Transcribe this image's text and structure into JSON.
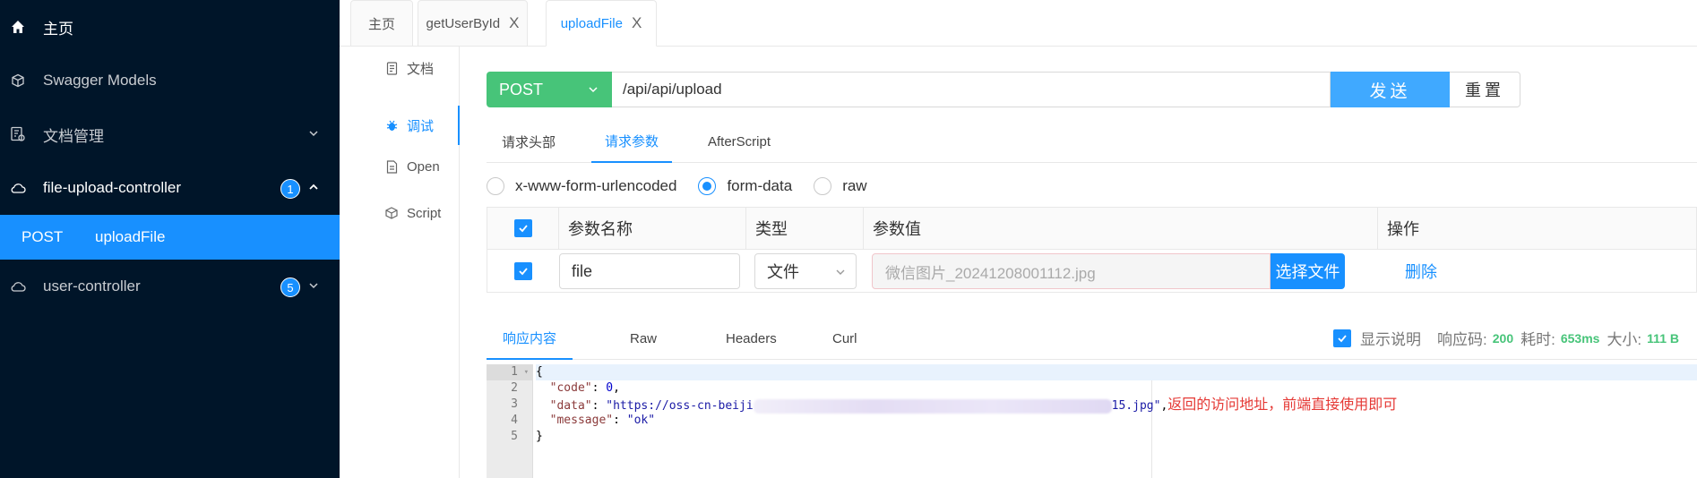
{
  "sidebar": {
    "home": "主页",
    "models": "Swagger Models",
    "docs": "文档管理",
    "group1": {
      "label": "file-upload-controller",
      "count": "1"
    },
    "active_item": {
      "method": "POST",
      "name": "uploadFile"
    },
    "group2": {
      "label": "user-controller",
      "count": "5"
    }
  },
  "tabs": [
    {
      "label": "主页"
    },
    {
      "label": "getUserById",
      "close": "X"
    },
    {
      "label": "uploadFile",
      "close": "X"
    }
  ],
  "vmenu": {
    "doc": "文档",
    "debug": "调试",
    "open": "Open",
    "script": "Script"
  },
  "request": {
    "method": "POST",
    "url": "/api/api/upload",
    "send": "发送",
    "reset": "重置"
  },
  "subtabs": [
    "请求头部",
    "请求参数",
    "AfterScript"
  ],
  "body_types": {
    "urlencoded": "x-www-form-urlencoded",
    "formdata": "form-data",
    "raw": "raw",
    "selected": "form-data"
  },
  "param_table": {
    "headers": {
      "name": "参数名称",
      "type": "类型",
      "value": "参数值",
      "action": "操作"
    },
    "row": {
      "name": "file",
      "type": "文件",
      "value_placeholder": "微信图片_20241208001112.jpg",
      "choose_file": "选择文件",
      "delete": "删除"
    }
  },
  "response_tabs": [
    "响应内容",
    "Raw",
    "Headers",
    "Curl"
  ],
  "response_info": {
    "show_desc": "显示说明",
    "code_label": "响应码:",
    "code": "200",
    "time_label": "耗时:",
    "time": "653ms",
    "size_label": "大小:",
    "size": "111 B"
  },
  "code_lines": {
    "l1": "{",
    "l2_key": "\"code\"",
    "l2_val": "0",
    "l3_key": "\"data\"",
    "l3_val_start": "\"https://oss-cn-beiji",
    "l3_val_end": "15.jpg\"",
    "l4_key": "\"message\"",
    "l4_val": "\"ok\"",
    "l5": "}",
    "annotation": "返回的访问地址，前端直接使用即可"
  },
  "line_numbers": [
    "1",
    "2",
    "3",
    "4",
    "5"
  ],
  "colors": {
    "sidebar_bg": "#001529",
    "accent": "#1890ff",
    "post_green": "#47c479",
    "send_blue": "#40a9ff",
    "annotation_red": "#e53935"
  }
}
